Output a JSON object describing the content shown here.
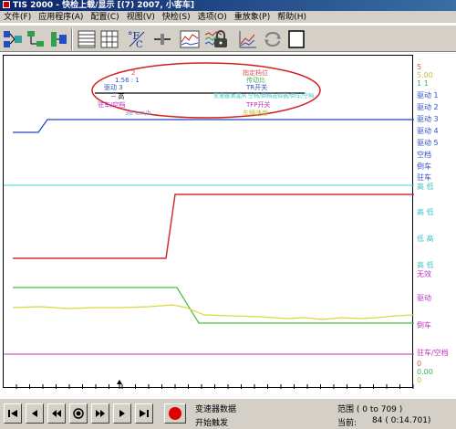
{
  "window": {
    "title": "TIS 2000 - 快检上载/显示 [(7) 2007, 小客车]"
  },
  "menu": [
    "文件(F)",
    "应用程序(A)",
    "配置(C)",
    "视图(V)",
    "快检(S)",
    "选项(O)",
    "重放象(P)",
    "帮助(H)"
  ],
  "toolbar": {
    "icons": [
      "connect-tree-icon",
      "network-icon",
      "device-list-icon",
      "grid-view-icon",
      "table-view-icon",
      "fc-unit-icon",
      "slider-icon",
      "waveform-icon",
      "multi-waveform-icon",
      "lock-icon",
      "chart-zoom-icon",
      "loop-arrows-icon",
      "blank-page-icon"
    ]
  },
  "plot": {
    "legend_box": {
      "lines": [
        {
          "text": "2",
          "color": "#e05050"
        },
        {
          "text": "1.56 : 1",
          "color": "#3050c0"
        },
        {
          "text": "驱动器",
          "color": "#3050c0"
        },
        {
          "text": "驱动 3",
          "color": "#3050c0"
        },
        {
          "text": "驻车/空档",
          "color": "#c030c0"
        },
        {
          "text": "36 km/h",
          "color": "#9090d0"
        },
        {
          "text": "指定档位",
          "color": "#e05050"
        },
        {
          "text": "传动比",
          "color": "#40b060"
        },
        {
          "text": "TR开关",
          "color": "#3050c0"
        },
        {
          "text": "变速器油温/R 空档/倒档选择器/倒车/空档",
          "color": "#40c0c0"
        },
        {
          "text": "TFP开关",
          "color": "#c030c0"
        },
        {
          "text": "车辆速度",
          "color": "#c0c040"
        }
      ]
    },
    "right_labels": [
      {
        "text": "5",
        "color": "#e05050"
      },
      {
        "text": "5.00",
        "color": "#c0c040"
      },
      {
        "text": "1 1",
        "color": "#40b060"
      },
      {
        "text": "驱动 1",
        "color": "#3050c0"
      },
      {
        "text": "驱动 2",
        "color": "#3050c0"
      },
      {
        "text": "驱动 3",
        "color": "#3050c0"
      },
      {
        "text": "驱动 4",
        "color": "#3050c0"
      },
      {
        "text": "驱动 5",
        "color": "#3050c0"
      },
      {
        "text": "空档",
        "color": "#3050c0"
      },
      {
        "text": "倒车",
        "color": "#3050c0"
      },
      {
        "text": "驻车",
        "color": "#3050c0"
      },
      {
        "text": "高 低",
        "color": "#40c0c0"
      },
      {
        "text": "高 低",
        "color": "#40c0c0"
      },
      {
        "text": "低 高",
        "color": "#40c0c0"
      },
      {
        "text": "高 低",
        "color": "#40c0c0"
      },
      {
        "text": "无效",
        "color": "#c030c0"
      },
      {
        "text": "驱动",
        "color": "#c030c0"
      },
      {
        "text": "倒车",
        "color": "#c030c0"
      },
      {
        "text": "驻车/空档",
        "color": "#c030c0"
      },
      {
        "text": "0",
        "color": "#e05050"
      },
      {
        "text": "0.00",
        "color": "#40b060"
      },
      {
        "text": "0",
        "color": "#c0c040"
      }
    ]
  },
  "status": {
    "label1": "变速器数据",
    "label2": "开始触发",
    "range": "范围 ( 0 to 709 )",
    "current_label": "当前:",
    "current_value": "84 ( 0:14.701)"
  },
  "colors": {
    "red": "#e05050",
    "blue": "#3050c0",
    "cyan": "#40d0d0",
    "green": "#40c040",
    "yellow": "#d8d840",
    "purple": "#c030c0",
    "ellipse": "#d02020"
  }
}
